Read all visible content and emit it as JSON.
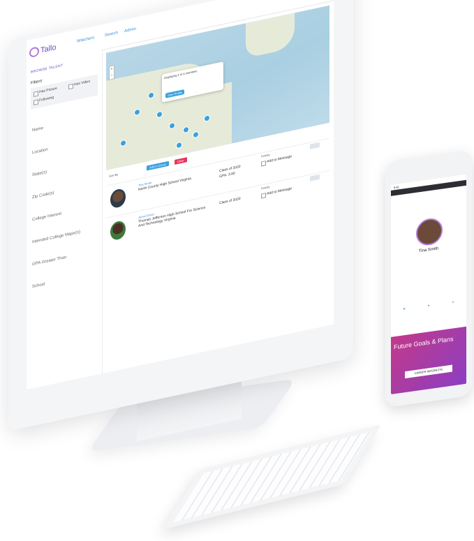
{
  "app": {
    "logo": "Tallo",
    "nav": [
      "Watchers",
      "Search",
      "Admin"
    ]
  },
  "sidebar": {
    "title": "BROWSE TALENT",
    "filters_label": "Filters",
    "options": [
      "Has Picture",
      "Has Video",
      "Following"
    ],
    "items": [
      "Name",
      "Location",
      "State(s)",
      "Zip Code(s)",
      "College Interest",
      "Intended College Major(s)",
      "GPA Greater Than",
      "School"
    ]
  },
  "map": {
    "popup_title": "Displaying 1 of 4 members",
    "popup_button": "View Profile"
  },
  "toolbar": {
    "dropdown": "Sort By",
    "blue_button": "Add to Group",
    "red_button": "Clear"
  },
  "rows": [
    {
      "name": "Tina Smith",
      "school": "North County High School Virginia",
      "class": "Class of 2020",
      "gpa": "GPA: 3.80",
      "label": "Fidelity",
      "add": "Add to Message"
    },
    {
      "name": "Jamal Green",
      "school": "Thomas Jefferson High School For Science And Technology Virginia",
      "class": "Class of 2020",
      "gpa": "",
      "label": "Fidelity",
      "add": "Add to Message"
    }
  ],
  "phone": {
    "time": "9:41",
    "name": "Tina Smith",
    "banner_title": "Future Goals & Plans",
    "careers_button": "CAREER INTERESTS"
  },
  "colors": {
    "brand_purple": "#6b4cc9",
    "accent_blue": "#3a8fd8",
    "accent_red": "#e8365d"
  }
}
